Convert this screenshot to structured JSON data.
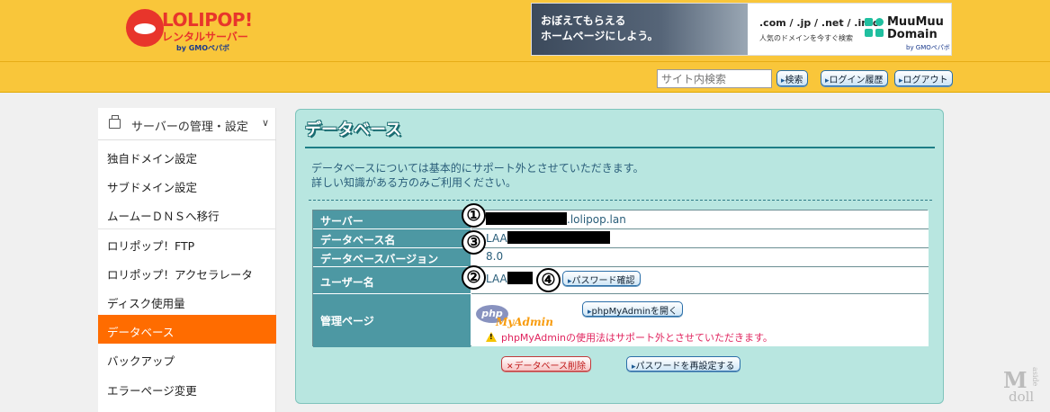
{
  "header": {
    "logo_text": "LOLIPOP!",
    "logo_sub": "レンタルサーバー",
    "logo_by": "by GMOペパボ",
    "banner": {
      "line1": "おぼえてもらえる",
      "line2": "ホームページにしよう。",
      "extensions": ".com / .jp / .net / .info",
      "tagline": "人気のドメインを今すぐ検索",
      "brand_line1": "MuuMuu",
      "brand_line2": "Domain",
      "brand_by": "by GMOペパボ"
    },
    "search_placeholder": "サイト内検索",
    "search_button": "検索",
    "login_history_button": "ログイン履歴",
    "logout_button": "ログアウト"
  },
  "sidebar": {
    "section_label": "サーバーの管理・設定",
    "items": [
      {
        "label": "独自ドメイン設定"
      },
      {
        "label": "サブドメイン設定"
      },
      {
        "label": "ムームーＤＮＳへ移行"
      },
      {
        "label": "ロリポップ！FTP"
      },
      {
        "label": "ロリポップ！アクセラレータ"
      },
      {
        "label": "ディスク使用量"
      },
      {
        "label": "データベース"
      },
      {
        "label": "バックアップ"
      },
      {
        "label": "エラーページ変更"
      }
    ],
    "active_index": 6
  },
  "panel": {
    "title": "データベース",
    "intro_line1": "データベースについては基本的にサポート外とさせていただきます。",
    "intro_line2": "詳しい知識がある方のみご利用ください。",
    "rows": [
      {
        "label": "サーバー",
        "value_suffix": ".lolipop.lan",
        "marker": "①"
      },
      {
        "label": "データベース名",
        "value_prefix": "LAA",
        "marker": "③"
      },
      {
        "label": "データベースバージョン",
        "value": "8.0"
      },
      {
        "label": "ユーザー名",
        "value_prefix": "LAA",
        "marker": "②",
        "marker2": "④",
        "button": "パスワード確認"
      },
      {
        "label": "管理ページ",
        "phpmyadmin_php": "php",
        "phpmyadmin_admin": "MyAdmin",
        "button": "phpMyAdminを開く",
        "warning": "phpMyAdminの使用法はサポート外とさせていただきます。"
      }
    ],
    "delete_button": "データベース削除",
    "reset_password_button": "パスワードを再設定する"
  },
  "watermark": {
    "line1": "M",
    "line2": "doll",
    "side": "aside"
  }
}
